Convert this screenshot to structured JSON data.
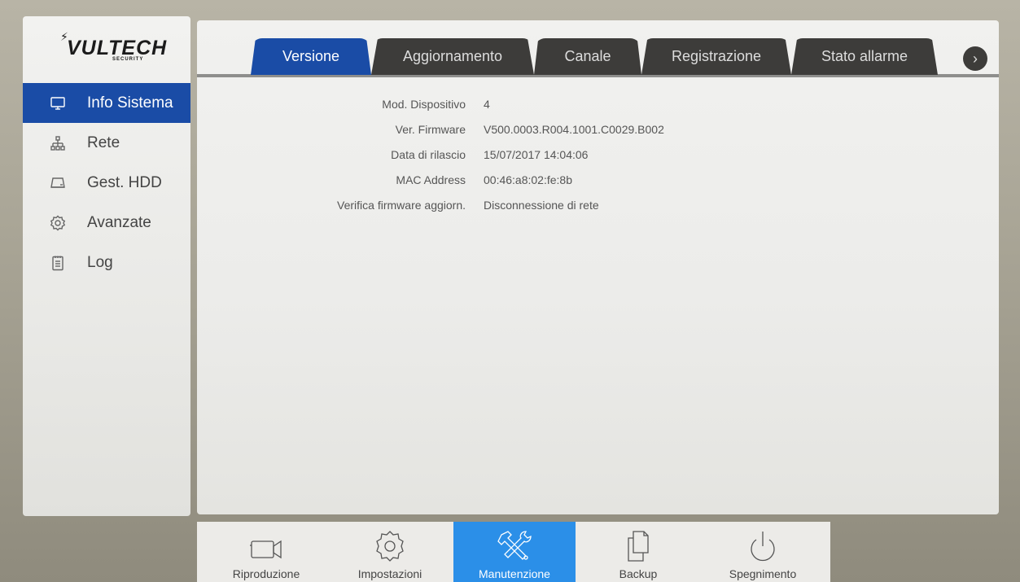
{
  "logo": {
    "brand": "VULTECH",
    "tagline": "SECURITY"
  },
  "sidebar": {
    "items": [
      {
        "label": "Info Sistema",
        "icon": "monitor-icon",
        "active": true
      },
      {
        "label": "Rete",
        "icon": "network-icon",
        "active": false
      },
      {
        "label": "Gest. HDD",
        "icon": "hdd-icon",
        "active": false
      },
      {
        "label": "Avanzate",
        "icon": "gear-icon",
        "active": false
      },
      {
        "label": "Log",
        "icon": "log-icon",
        "active": false
      }
    ]
  },
  "tabs": [
    {
      "label": "Versione",
      "active": true
    },
    {
      "label": "Aggiornamento",
      "active": false
    },
    {
      "label": "Canale",
      "active": false
    },
    {
      "label": "Registrazione",
      "active": false
    },
    {
      "label": "Stato allarme",
      "active": false
    }
  ],
  "tab_next_icon": "chevron-right-icon",
  "info": [
    {
      "label": "Mod. Dispositivo",
      "value": "4"
    },
    {
      "label": "Ver. Firmware",
      "value": "V500.0003.R004.1001.C0029.B002"
    },
    {
      "label": "Data di rilascio",
      "value": "15/07/2017 14:04:06"
    },
    {
      "label": "MAC Address",
      "value": "00:46:a8:02:fe:8b"
    },
    {
      "label": "Verifica firmware aggiorn.",
      "value": "Disconnessione di rete"
    }
  ],
  "bottombar": {
    "items": [
      {
        "label": "Riproduzione",
        "icon": "camera-icon",
        "active": false
      },
      {
        "label": "Impostazioni",
        "icon": "settings-gear-icon",
        "active": false
      },
      {
        "label": "Manutenzione",
        "icon": "tools-icon",
        "active": true
      },
      {
        "label": "Backup",
        "icon": "copy-icon",
        "active": false
      },
      {
        "label": "Spegnimento",
        "icon": "power-icon",
        "active": false
      }
    ]
  },
  "colors": {
    "accent_blue": "#1a4ca6",
    "bottom_active": "#2b8fe8",
    "tab_dark": "#3d3c3a"
  }
}
